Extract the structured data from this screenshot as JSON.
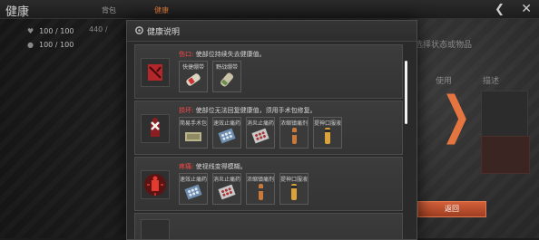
{
  "screen": {
    "title": "健康",
    "tabs": [
      "背包",
      "健康"
    ],
    "stats": [
      {
        "value": "100 / 100"
      },
      {
        "value": "100 / 100"
      }
    ],
    "tab_extra": "440 /"
  },
  "right_panel": {
    "hint": "选择状态或物品",
    "col_use": "使用",
    "col_desc": "描述",
    "return_label": "返回"
  },
  "dialog": {
    "title": "健康说明",
    "entries": [
      {
        "keyword": "伤口:",
        "text": " 使部位持续失去健康值。",
        "items": [
          {
            "label": "快捷绷带",
            "icon": "bandage-roll-icon"
          },
          {
            "label": "野战绷带",
            "icon": "field-bandage-icon"
          }
        ]
      },
      {
        "keyword": "损坏:",
        "text": " 使部位无法回复健康值，须用手术包修复。",
        "items": [
          {
            "label": "简易手术包",
            "icon": "surgery-kit-icon"
          },
          {
            "label": "速效止痛药",
            "icon": "blister-pack-icon"
          },
          {
            "label": "消炎止痛药",
            "icon": "blister-pack-icon"
          },
          {
            "label": "浓缩镇痛剂",
            "icon": "injector-icon"
          },
          {
            "label": "提神口服液",
            "icon": "oral-vial-icon"
          }
        ]
      },
      {
        "keyword": "疼痛:",
        "text": " 使视线变得模糊。",
        "items": [
          {
            "label": "速效止痛药",
            "icon": "blister-pack-icon"
          },
          {
            "label": "消炎止痛药",
            "icon": "blister-pack-icon"
          },
          {
            "label": "浓缩镇痛剂",
            "icon": "injector-icon"
          },
          {
            "label": "提神口服液",
            "icon": "oral-vial-icon"
          }
        ]
      }
    ]
  },
  "colors": {
    "accent": "#e57540",
    "keyword": "#ff4a4a"
  }
}
